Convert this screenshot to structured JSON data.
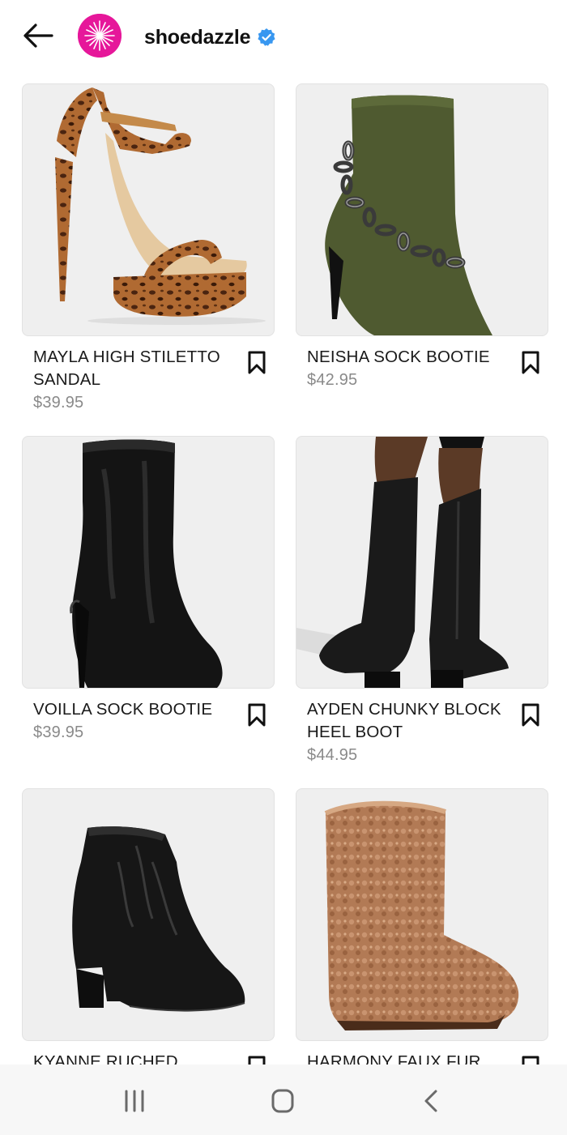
{
  "header": {
    "back_icon": "arrow-left-icon",
    "avatar_icon": "sparkle-logo-icon",
    "avatar_color": "#e6179a",
    "brand_name": "shoedazzle",
    "verified_icon": "verified-badge-icon",
    "verified_color": "#3897f0"
  },
  "products": [
    {
      "name": "MAYLA HIGH STILETTO SANDAL",
      "price": "$39.95",
      "image": "leopard-platform-sandal",
      "save_icon": "bookmark-icon"
    },
    {
      "name": "NEISHA SOCK BOOTIE",
      "price": "$42.95",
      "image": "olive-chain-sock-bootie",
      "save_icon": "bookmark-icon"
    },
    {
      "name": "VOILLA SOCK BOOTIE",
      "price": "$39.95",
      "image": "black-sock-bootie",
      "save_icon": "bookmark-icon"
    },
    {
      "name": "AYDEN CHUNKY BLOCK HEEL BOOT",
      "price": "$44.95",
      "image": "black-knee-high-boots",
      "save_icon": "bookmark-icon"
    },
    {
      "name": "KYANNE RUCHED",
      "price": "",
      "image": "black-ruched-bootie",
      "save_icon": "bookmark-icon"
    },
    {
      "name": "HARMONY FAUX FUR",
      "price": "",
      "image": "tan-faux-fur-boot",
      "save_icon": "bookmark-icon"
    }
  ],
  "system_nav": {
    "recents_icon": "recent-apps-icon",
    "home_icon": "home-icon",
    "back_icon": "back-chevron-icon"
  }
}
